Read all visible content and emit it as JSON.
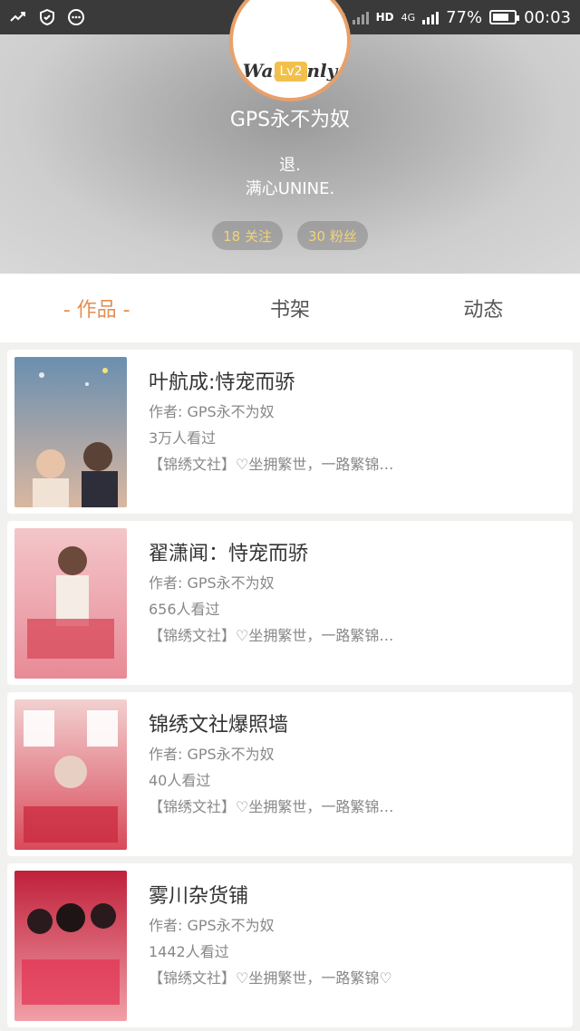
{
  "status_bar": {
    "battery_percent": "77%",
    "battery_level": 0.77,
    "time": "00:03",
    "network": "4G"
  },
  "profile": {
    "avatar_text": "Wantonly",
    "level": "Lv2",
    "username": "GPS永不为奴",
    "bio_line1": "退.",
    "bio_line2": "满心UNINE.",
    "following": "18 关注",
    "followers": "30 粉丝"
  },
  "tabs": [
    {
      "label": "- 作品 -",
      "active": true
    },
    {
      "label": "书架",
      "active": false
    },
    {
      "label": "动态",
      "active": false
    }
  ],
  "books": [
    {
      "title": "叶航成:恃宠而骄",
      "author": "作者: GPS永不为奴",
      "views": "3万人看过",
      "desc": "【锦绣文社】♡坐拥繁世，一路繁锦…",
      "cover_colors": [
        "#6a8fb0",
        "#d9b7a0"
      ]
    },
    {
      "title": "翟潇闻：恃宠而骄",
      "author": "作者: GPS永不为奴",
      "views": "656人看过",
      "desc": "【锦绣文社】♡坐拥繁世，一路繁锦…",
      "cover_colors": [
        "#f3c6c9",
        "#e88a96"
      ]
    },
    {
      "title": "锦绣文社爆照墙",
      "author": "作者: GPS永不为奴",
      "views": "40人看过",
      "desc": "【锦绣文社】♡坐拥繁世，一路繁锦…",
      "cover_colors": [
        "#f2d0d0",
        "#d94a5a"
      ]
    },
    {
      "title": "雾川杂货铺",
      "author": "作者: GPS永不为奴",
      "views": "1442人看过",
      "desc": "【锦绣文社】♡坐拥繁世，一路繁锦♡",
      "cover_colors": [
        "#c0203a",
        "#f1a0a8"
      ]
    }
  ]
}
